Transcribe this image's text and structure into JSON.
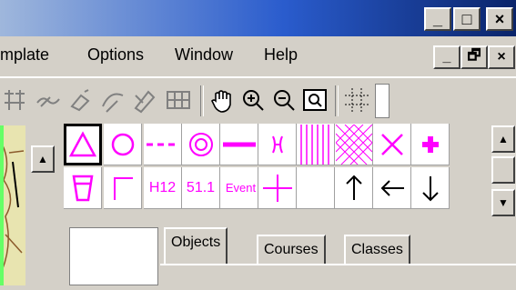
{
  "window": {
    "minimize": "_",
    "maximize": "□",
    "close": "×"
  },
  "menubar": {
    "items": [
      "mplate",
      "Options",
      "Window",
      "Help"
    ],
    "doc_minimize": "_",
    "doc_restore": "🗗",
    "doc_close": "×"
  },
  "toolbar": {
    "icons": [
      "symbol-tool-icon",
      "brush-tool-icon",
      "spray-tool-icon",
      "curve-tool-icon",
      "pen-tool-icon",
      "grid-tool-icon",
      "hand-pan-icon",
      "zoom-in-icon",
      "zoom-out-icon",
      "zoom-fit-icon",
      "crosshair-grid-icon"
    ]
  },
  "palette": {
    "row2_labels": {
      "h12": "H12",
      "p511": "51.1",
      "event": "Event"
    }
  },
  "tabs": {
    "objects": "Objects",
    "courses": "Courses",
    "classes": "Classes"
  },
  "colors": {
    "symbol": "#ff00ff",
    "title_dark": "#0a246a",
    "title_light": "#9fb7dc",
    "face": "#d4d0c8"
  }
}
